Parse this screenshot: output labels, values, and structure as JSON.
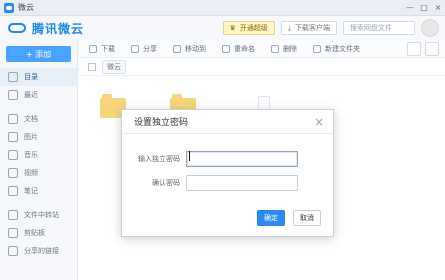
{
  "window": {
    "title": "微云",
    "controls": [
      "—",
      "□",
      "×"
    ]
  },
  "header": {
    "brand": "腾讯微云",
    "vip_button": "开通超级",
    "download_button": "下载客户端",
    "search_placeholder": "搜索网盘文件"
  },
  "sidebar": {
    "upload_label": "+ 添加",
    "items": [
      {
        "label": "目录",
        "icon": "folder-icon",
        "active": true
      },
      {
        "label": "最近",
        "icon": "clock-icon",
        "active": false
      },
      {
        "label": "文档",
        "icon": "doc-icon",
        "active": false
      },
      {
        "label": "图片",
        "icon": "image-icon",
        "active": false
      },
      {
        "label": "音乐",
        "icon": "music-icon",
        "active": false
      },
      {
        "label": "视频",
        "icon": "video-icon",
        "active": false
      },
      {
        "label": "笔记",
        "icon": "note-icon",
        "active": false
      },
      {
        "label": "文件中转站",
        "icon": "transfer-icon",
        "active": false
      },
      {
        "label": "剪贴板",
        "icon": "clipboard-icon",
        "active": false
      },
      {
        "label": "分享的链接",
        "icon": "link-icon",
        "active": false
      }
    ]
  },
  "toolbar": {
    "download": "下载",
    "share": "分享",
    "move_to": "移动到",
    "rename": "重命名",
    "delete": "删除",
    "new_folder": "新建文件夹"
  },
  "breadcrumb": {
    "root": "微云"
  },
  "dialog": {
    "title": "设置独立密码",
    "close": "×",
    "password_label": "输入独立密码",
    "confirm_label": "确认密码",
    "confirm_button": "确定",
    "cancel_button": "取消"
  },
  "colors": {
    "accent": "#2d8cf0",
    "folder": "#f6d57c",
    "vip": "#fff6c8"
  }
}
